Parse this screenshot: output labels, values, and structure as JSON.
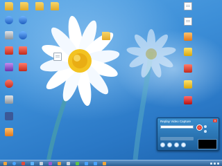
{
  "desktop": {
    "icons": [
      {
        "label": "",
        "glyph": "folder"
      },
      {
        "label": "",
        "glyph": "folder"
      },
      {
        "label": "",
        "glyph": "folder"
      },
      {
        "label": "",
        "glyph": "app-blue"
      },
      {
        "label": "",
        "glyph": "app-gray"
      },
      {
        "label": "",
        "glyph": "app-red"
      },
      {
        "label": "",
        "glyph": "app-purple"
      },
      {
        "label": "",
        "glyph": "app-red"
      },
      {
        "label": "",
        "glyph": "app-gray"
      },
      {
        "label": "",
        "glyph": "app-red"
      },
      {
        "label": "",
        "glyph": "app-fb"
      },
      {
        "label": "",
        "glyph": "app-red"
      },
      {
        "label": "",
        "glyph": "app-orange"
      },
      {
        "label": "",
        "glyph": "folder"
      },
      {
        "label": "",
        "glyph": "folder"
      },
      {
        "label": "",
        "glyph": "app-blue"
      },
      {
        "label": "",
        "glyph": "app-blue"
      },
      {
        "label": "",
        "glyph": "doc"
      },
      {
        "label": "",
        "glyph": "doc"
      },
      {
        "label": "",
        "glyph": "doc"
      },
      {
        "label": "",
        "glyph": "app-orange"
      },
      {
        "label": "",
        "glyph": "app-yellow"
      },
      {
        "label": "",
        "glyph": "app-red"
      },
      {
        "label": "",
        "glyph": "app-yellow"
      },
      {
        "label": "",
        "glyph": "app-pdf"
      },
      {
        "label": "",
        "glyph": "doc"
      }
    ]
  },
  "replay_video_capture": {
    "title": "Replay Video Capture",
    "close_label": "×",
    "recording_input": "",
    "capture_button": "",
    "side_buttons": [
      "",
      ""
    ],
    "controls": [
      "",
      "",
      "",
      ""
    ]
  },
  "taskbar": {
    "apps": [
      "app-orange",
      "app-blue",
      "app-red",
      "app-blue",
      "app-gray",
      "app-purple",
      "app-orange",
      "app-gray",
      "app-green",
      "app-blue",
      "app-blue",
      "app-orange"
    ],
    "clock_time": "",
    "clock_date": ""
  },
  "colors": {
    "wallpaper_blue": "#3d8fd8",
    "taskbar_blue": "#2c5f93",
    "widget_blue": "#2a72b4",
    "petal_white": "#ffffff",
    "flower_center": "#f3c321"
  }
}
